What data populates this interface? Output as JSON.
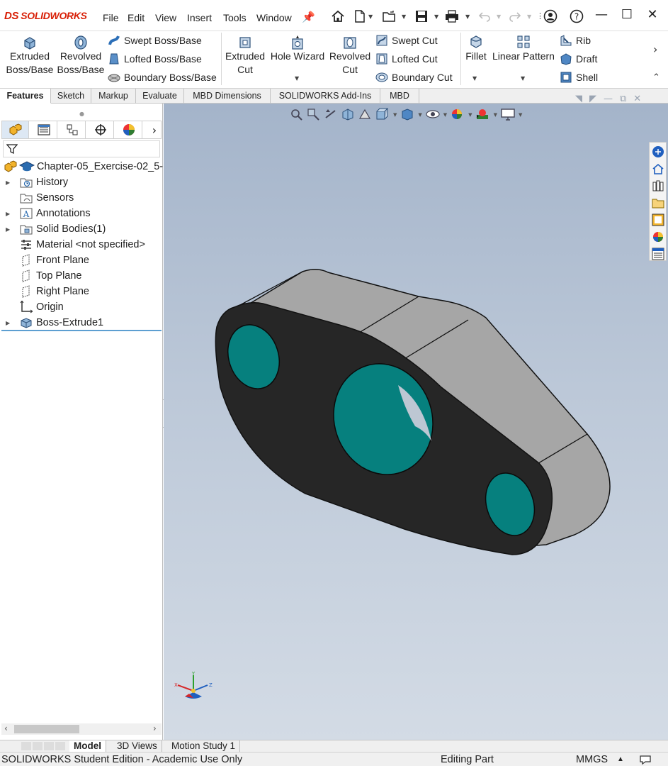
{
  "app": {
    "logo_text": "SOLIDWORKS",
    "logo_prefix": "DS"
  },
  "menu": [
    "File",
    "Edit",
    "View",
    "Insert",
    "Tools",
    "Window"
  ],
  "ribbon": {
    "extruded_boss": [
      "Extruded",
      "Boss/Base"
    ],
    "revolved_boss": [
      "Revolved",
      "Boss/Base"
    ],
    "swept_boss": "Swept Boss/Base",
    "lofted_boss": "Lofted Boss/Base",
    "boundary_boss": "Boundary Boss/Base",
    "extruded_cut": [
      "Extruded",
      "Cut"
    ],
    "hole_wizard": "Hole Wizard",
    "revolved_cut": [
      "Revolved",
      "Cut"
    ],
    "swept_cut": "Swept Cut",
    "lofted_cut": "Lofted Cut",
    "boundary_cut": "Boundary Cut",
    "fillet": "Fillet",
    "linear_pattern": "Linear Pattern",
    "rib": "Rib",
    "draft": "Draft",
    "shell": "Shell"
  },
  "tabs": [
    "Features",
    "Sketch",
    "Markup",
    "Evaluate",
    "MBD Dimensions",
    "SOLIDWORKS Add-Ins",
    "MBD"
  ],
  "tree": {
    "root": "Chapter-05_Exercise-02_5-",
    "items": [
      "History",
      "Sensors",
      "Annotations",
      "Solid Bodies(1)",
      "Material <not specified>",
      "Front Plane",
      "Top Plane",
      "Right Plane",
      "Origin",
      "Boss-Extrude1"
    ]
  },
  "triad": {
    "x": "X",
    "y": "Y",
    "z": "Z"
  },
  "bottom_tabs": [
    "Model",
    "3D Views",
    "Motion Study 1"
  ],
  "status": {
    "edition": "SOLIDWORKS Student Edition - Academic Use Only",
    "mode": "Editing Part",
    "units": "MMGS"
  },
  "colors": {
    "body_face": "#262626",
    "side_face": "#a6a6a6",
    "hole": "#06807e",
    "background_top": "#a4b4ca",
    "background_bottom": "#d3dbe5",
    "brand": "#d81e05"
  }
}
